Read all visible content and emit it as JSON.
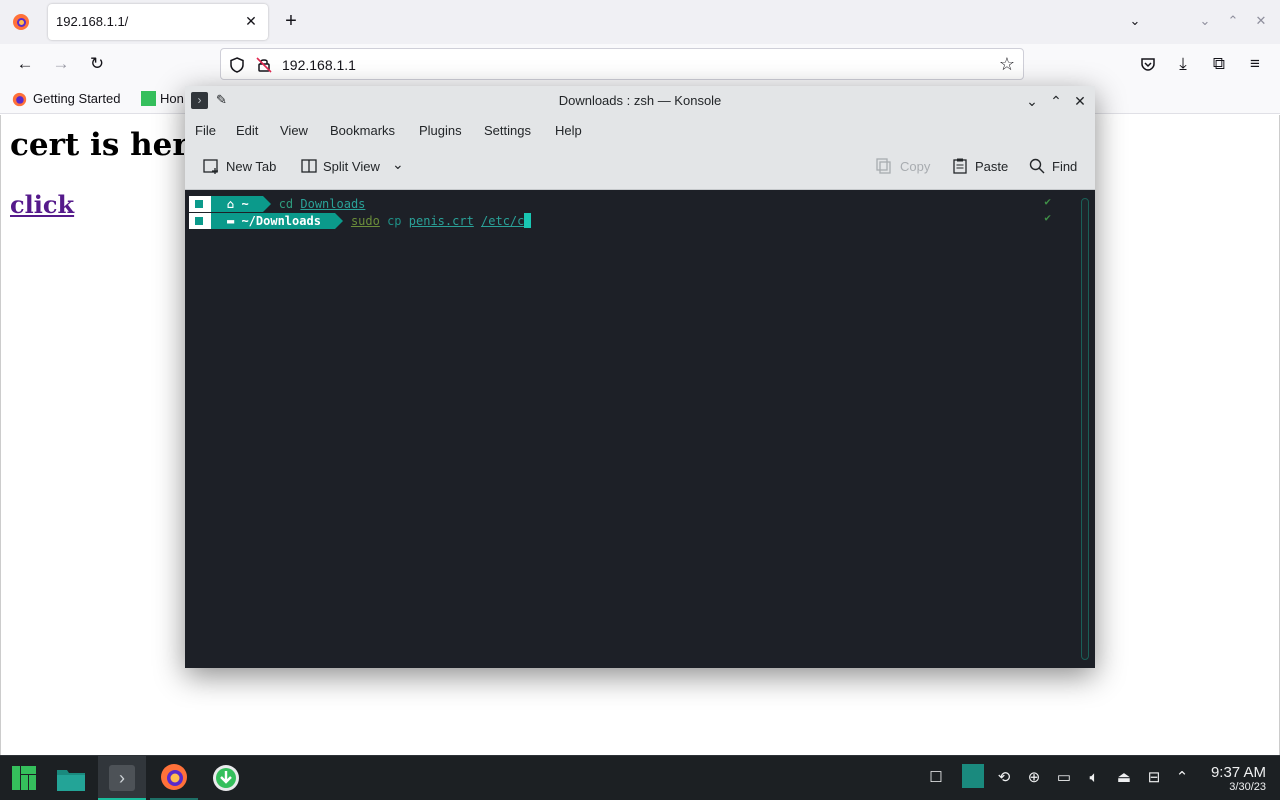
{
  "browser": {
    "tab_title": "192.168.1.1/",
    "url": "192.168.1.1",
    "bookmarks": [
      "Getting Started",
      "Hon"
    ],
    "accent": "#15141a"
  },
  "page": {
    "heading": "cert is here",
    "link": "click",
    "link_color": "#551a8b"
  },
  "konsole": {
    "title": "Downloads : zsh — Konsole",
    "menu": [
      "File",
      "Edit",
      "View",
      "Bookmarks",
      "Plugins",
      "Settings",
      "Help"
    ],
    "toolbar": {
      "new_tab": "New Tab",
      "split_view": "Split View",
      "copy": "Copy",
      "paste": "Paste",
      "find": "Find"
    },
    "terminal": {
      "line1": {
        "dir": "~",
        "cmd_word": "cd",
        "cmd_arg": "Downloads"
      },
      "line2": {
        "dir": "~/Downloads",
        "cmd_word": "sudo",
        "cmd_rest": "cp",
        "arg1": "penis.crt",
        "arg2": "/etc/c"
      },
      "accent": "#0b9a8b",
      "background": "#1d2027"
    }
  },
  "taskbar": {
    "time": "9:37 AM",
    "date": "3/30/23",
    "apps": [
      "manjaro-menu-icon",
      "file-manager-icon",
      "konsole-icon",
      "firefox-icon",
      "download-manager-icon"
    ],
    "accent": "#1abc9c"
  }
}
